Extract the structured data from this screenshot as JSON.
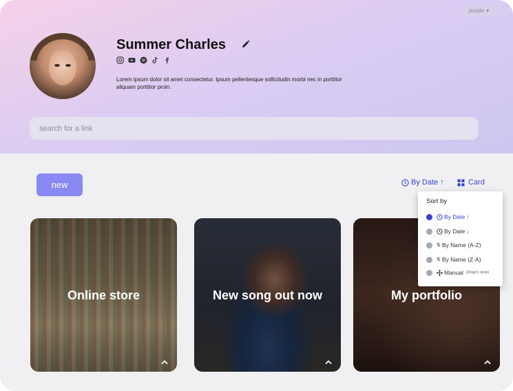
{
  "theme": {
    "selected": "purple"
  },
  "profile": {
    "name": "Summer Charles",
    "bio": "Lorem ipsum dolor sit amet consectetur. Ipsum pellentesque sollicitudin morbi nec in porttitor aliquam porttitor proin.",
    "socials": [
      "instagram-icon",
      "youtube-icon",
      "spotify-icon",
      "tiktok-icon",
      "facebook-icon"
    ]
  },
  "search": {
    "placeholder": "search for a link"
  },
  "toolbar": {
    "new_label": "new",
    "sort_label": "By Date",
    "view_label": "Card"
  },
  "sort_menu": {
    "title": "Sort by",
    "options": [
      {
        "label": "By Date",
        "icon": "clock-icon",
        "arrow": "↑",
        "active": true
      },
      {
        "label": "By Date",
        "icon": "clock-icon",
        "arrow": "↓",
        "active": false
      },
      {
        "label": "By Name (A-Z)",
        "icon": "sort-az-icon",
        "active": false
      },
      {
        "label": "By Name (Z-A)",
        "icon": "sort-za-icon",
        "active": false
      },
      {
        "label": "Manual",
        "icon": "move-icon",
        "hint": "(Drag'n' drop)",
        "active": false
      }
    ]
  },
  "cards": [
    {
      "title": "Online store"
    },
    {
      "title": "New song out now"
    },
    {
      "title": "My portfolio"
    }
  ],
  "colors": {
    "accent": "#3b3fcf",
    "button": "#8a88f2"
  }
}
